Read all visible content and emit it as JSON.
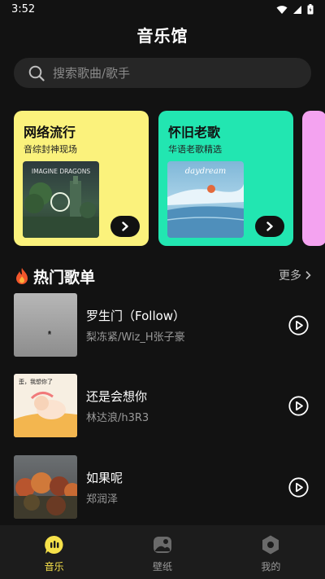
{
  "status_bar": {
    "time": "3:52"
  },
  "header": {
    "title": "音乐馆"
  },
  "search": {
    "placeholder": "搜索歌曲/歌手"
  },
  "featured": [
    {
      "title": "网络流行",
      "subtitle": "音综封神现场",
      "color": "#fbf27c",
      "cover_text": "IMAGINE DRAGONS"
    },
    {
      "title": "怀旧老歌",
      "subtitle": "华语老歌精选",
      "color": "#22e6b1",
      "cover_text": "daydream"
    },
    {
      "color": "#f4a3f0"
    }
  ],
  "hot_section": {
    "title": "热门歌单",
    "more_label": "更多"
  },
  "songs": [
    {
      "title": "罗生门（Follow）",
      "artist": "梨冻紧/Wiz_H张子豪"
    },
    {
      "title": "还是会想你",
      "artist": "林达浪/h3R3",
      "cover_text": "歪，我想你了"
    },
    {
      "title": "如果呢",
      "artist": "郑润泽"
    }
  ],
  "tabs": [
    {
      "label": "音乐",
      "icon": "music-chat-icon",
      "active": true
    },
    {
      "label": "壁纸",
      "icon": "wallpaper-icon",
      "active": false
    },
    {
      "label": "我的",
      "icon": "profile-hexagon-icon",
      "active": false
    }
  ],
  "colors": {
    "accent": "#f6e14a",
    "background": "#121212",
    "tabbar": "#1c1c1c"
  }
}
